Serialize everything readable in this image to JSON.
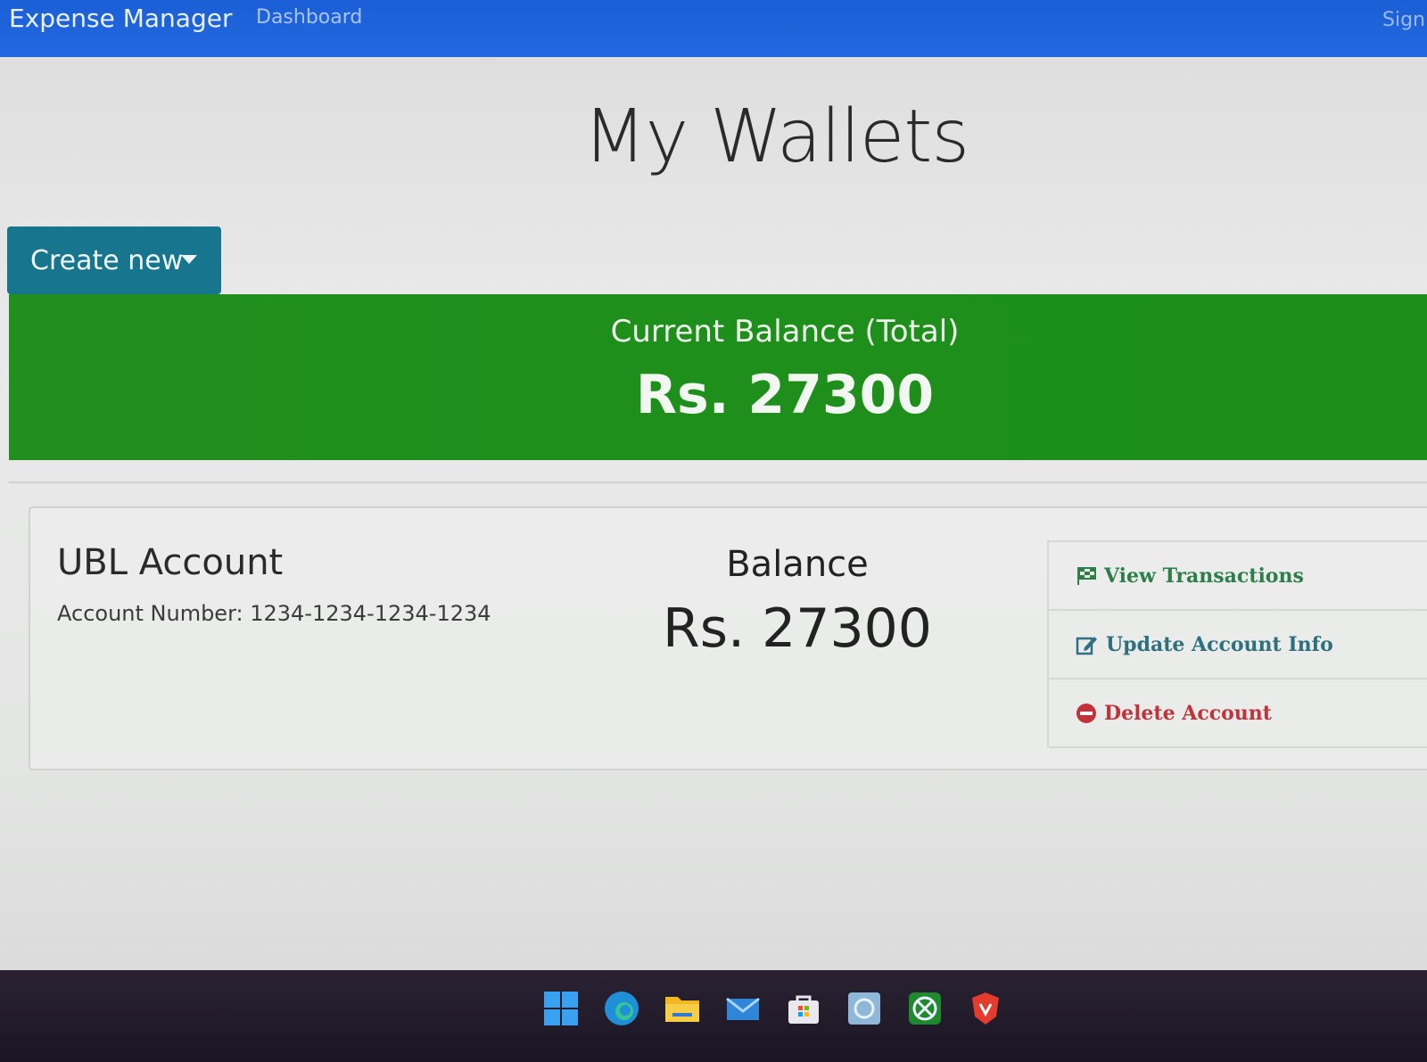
{
  "navbar": {
    "brand": "Expense Manager",
    "links": [
      "Dashboard"
    ],
    "right_link": "Sign"
  },
  "page": {
    "title": "My Wallets"
  },
  "create_button": {
    "label": "Create new"
  },
  "total": {
    "label": "Current Balance (Total)",
    "value": "Rs. 27300"
  },
  "wallet": {
    "name": "UBL Account",
    "account_number": "Account Number: 1234-1234-1234-1234",
    "balance_label": "Balance",
    "balance_value": "Rs. 27300",
    "actions": [
      {
        "label": "View Transactions",
        "icon": "flag-icon",
        "color": "#2d7f49"
      },
      {
        "label": "Update Account Info",
        "icon": "edit-icon",
        "color": "#2f6f80"
      },
      {
        "label": "Delete Account",
        "icon": "minus-circle-icon",
        "color": "#c1323a"
      }
    ]
  },
  "taskbar": {
    "icons": [
      "windows-start-icon",
      "edge-browser-icon",
      "file-explorer-icon",
      "mail-icon",
      "store-icon",
      "photos-icon",
      "xbox-icon",
      "brave-browser-icon"
    ]
  },
  "colors": {
    "navbar": "#1b5fd6",
    "create_button": "#17768d",
    "total_banner": "#1d8f1a"
  }
}
